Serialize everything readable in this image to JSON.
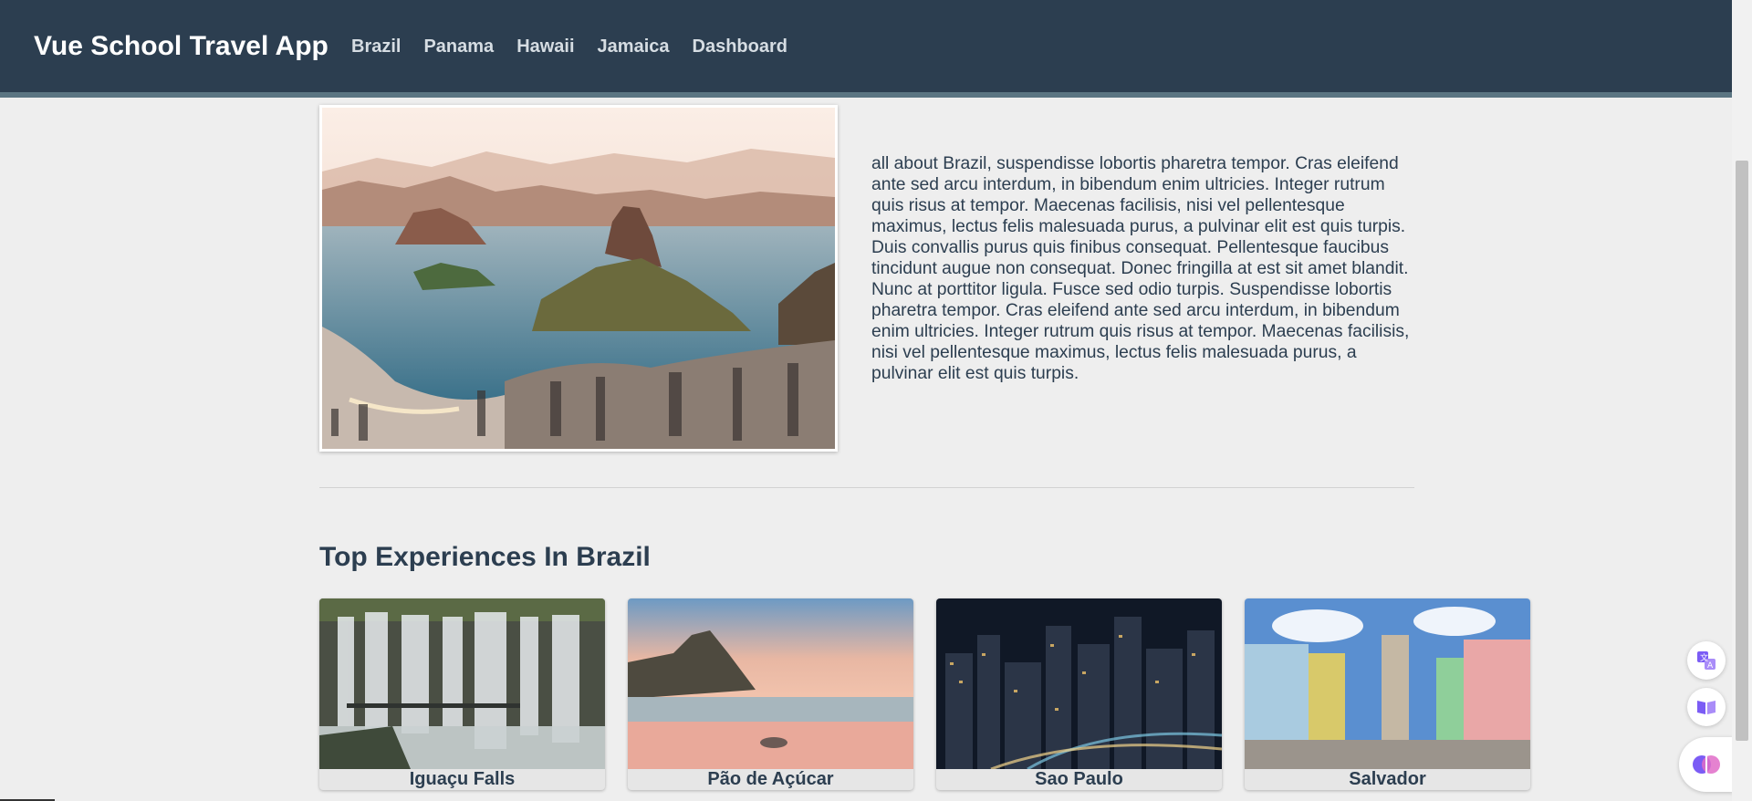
{
  "app": {
    "title": "Vue School Travel App"
  },
  "nav": {
    "links": [
      "Brazil",
      "Panama",
      "Hawaii",
      "Jamaica",
      "Dashboard"
    ]
  },
  "destination": {
    "name": "Brazil",
    "image_icon": "rio-de-janeiro-photo",
    "description": "all about Brazil, suspendisse lobortis pharetra tempor. Cras eleifend ante sed arcu interdum, in bibendum enim ultricies. Integer rutrum quis risus at tempor. Maecenas facilisis, nisi vel pellentesque maximus, lectus felis malesuada purus, a pulvinar elit est quis turpis. Duis convallis purus quis finibus consequat. Pellentesque faucibus tincidunt augue non consequat. Donec fringilla at est sit amet blandit. Nunc at porttitor ligula. Fusce sed odio turpis. Suspendisse lobortis pharetra tempor. Cras eleifend ante sed arcu interdum, in bibendum enim ultricies. Integer rutrum quis risus at tempor. Maecenas facilisis, nisi vel pellentesque maximus, lectus felis malesuada purus, a pulvinar elit est quis turpis."
  },
  "experiences": {
    "title": "Top Experiences In Brazil",
    "items": [
      {
        "name": "Iguaçu Falls",
        "image": "waterfall-photo"
      },
      {
        "name": "Pão de Açúcar",
        "image": "sugarloaf-beach-photo"
      },
      {
        "name": "Sao Paulo",
        "image": "night-city-photo"
      },
      {
        "name": "Salvador",
        "image": "colonial-street-photo"
      }
    ]
  },
  "floating_tools": {
    "icons": [
      "translate-icon",
      "reader-icon",
      "ai-brain-icon"
    ]
  },
  "colors": {
    "navbar": "#2c3e50",
    "nav_border": "#5b7582",
    "page_bg": "#eeeeee",
    "text": "#2c3e50",
    "accent": "#7b5cf5"
  }
}
